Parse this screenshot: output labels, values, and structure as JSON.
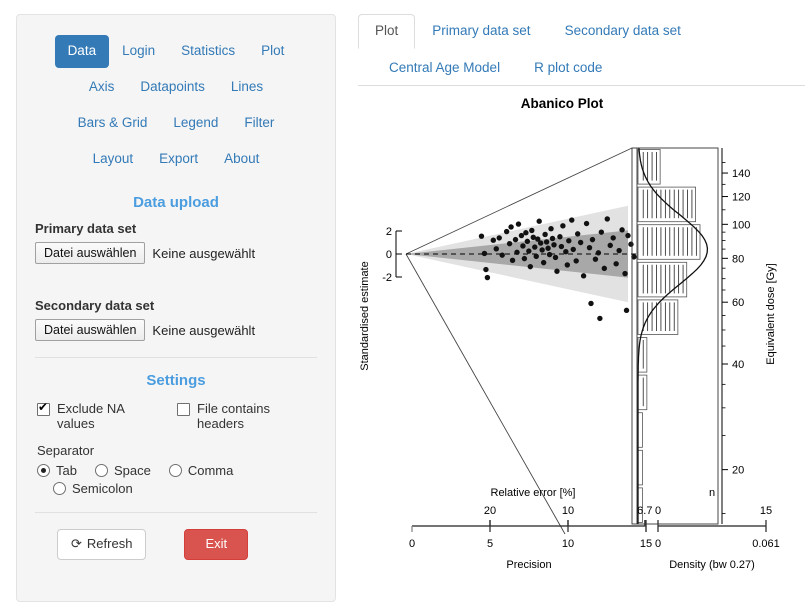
{
  "sidebar": {
    "nav_rows": [
      [
        {
          "label": "Data",
          "active": true
        },
        {
          "label": "Login",
          "active": false
        },
        {
          "label": "Statistics",
          "active": false
        },
        {
          "label": "Plot",
          "active": false
        }
      ],
      [
        {
          "label": "Axis",
          "active": false
        },
        {
          "label": "Datapoints",
          "active": false
        },
        {
          "label": "Lines",
          "active": false
        }
      ],
      [
        {
          "label": "Bars & Grid",
          "active": false
        },
        {
          "label": "Legend",
          "active": false
        },
        {
          "label": "Filter",
          "active": false
        }
      ],
      [
        {
          "label": "Layout",
          "active": false
        },
        {
          "label": "Export",
          "active": false
        },
        {
          "label": "About",
          "active": false
        }
      ]
    ],
    "data_upload": {
      "title": "Data upload",
      "primary_label": "Primary data set",
      "primary_button": "Datei auswählen",
      "primary_status": "Keine ausgewählt",
      "secondary_label": "Secondary data set",
      "secondary_button": "Datei auswählen",
      "secondary_status": "Keine ausgewählt"
    },
    "settings": {
      "title": "Settings",
      "checkboxes": [
        {
          "label": "Exclude NA values",
          "checked": true
        },
        {
          "label": "File contains headers",
          "checked": false
        }
      ],
      "separator_label": "Separator",
      "separator_options": [
        {
          "label": "Tab",
          "checked": true
        },
        {
          "label": "Space",
          "checked": false
        },
        {
          "label": "Comma",
          "checked": false
        },
        {
          "label": "Semicolon",
          "checked": false
        }
      ]
    },
    "buttons": {
      "refresh_label": "Refresh",
      "refresh_icon": "⟳",
      "exit_label": "Exit"
    }
  },
  "main": {
    "tab_rows": [
      [
        {
          "label": "Plot",
          "active": true
        },
        {
          "label": "Primary data set",
          "active": false
        },
        {
          "label": "Secondary data set",
          "active": false
        }
      ],
      [
        {
          "label": "Central Age Model",
          "active": false
        },
        {
          "label": "R plot code",
          "active": false
        }
      ]
    ]
  },
  "chart_data": {
    "type": "scatter",
    "title": "Abanico Plot",
    "ylabel_left": "Standardised estimate",
    "ylabel_right": "Equivalent dose [Gy]",
    "top_axis_label": "Relative error [%]",
    "top_axis_ticks": [
      "20",
      "10",
      "6.7"
    ],
    "top_axis_tick_values": [
      20,
      10,
      6.7
    ],
    "bottom_axis_label": "Precision",
    "bottom_axis_ticks": [
      "0",
      "5",
      "10",
      "15"
    ],
    "bottom_axis_tick_values": [
      0,
      5,
      10,
      15
    ],
    "density_top_label": "n",
    "density_top_ticks": [
      "0",
      "15"
    ],
    "density_top_tick_values": [
      0,
      15
    ],
    "density_bottom_label": "Density (bw 0.27)",
    "density_bottom_ticks": [
      "0",
      "0.061"
    ],
    "density_bottom_tick_values": [
      0,
      0.061
    ],
    "left_axis_ticks": [
      "2",
      "0",
      "-2"
    ],
    "left_axis_tick_values": [
      2,
      0,
      -2
    ],
    "right_axis_ticks": [
      "140",
      "120",
      "100",
      "80",
      "60",
      "40",
      "20"
    ],
    "right_axis_tick_values": [
      140,
      120,
      100,
      80,
      60,
      40,
      20
    ],
    "right_axis_scale": "log",
    "central_value": 67,
    "grid": false,
    "legend": "none",
    "points": [
      [
        5.1,
        1.55
      ],
      [
        5.3,
        0.05
      ],
      [
        5.4,
        -1.35
      ],
      [
        5.5,
        -2.05
      ],
      [
        5.9,
        1.2
      ],
      [
        6.1,
        0.45
      ],
      [
        6.3,
        1.4
      ],
      [
        6.5,
        -0.1
      ],
      [
        6.8,
        1.95
      ],
      [
        7.0,
        0.9
      ],
      [
        7.1,
        2.35
      ],
      [
        7.2,
        -0.55
      ],
      [
        7.4,
        1.25
      ],
      [
        7.5,
        0.15
      ],
      [
        7.6,
        2.6
      ],
      [
        7.8,
        1.6
      ],
      [
        7.9,
        0.7
      ],
      [
        8.0,
        -0.4
      ],
      [
        8.1,
        1.85
      ],
      [
        8.2,
        1.1
      ],
      [
        8.3,
        0.25
      ],
      [
        8.4,
        -1.1
      ],
      [
        8.5,
        2.05
      ],
      [
        8.6,
        1.45
      ],
      [
        8.7,
        0.6
      ],
      [
        8.8,
        -0.2
      ],
      [
        8.9,
        1.3
      ],
      [
        9.0,
        2.85
      ],
      [
        9.1,
        0.95
      ],
      [
        9.2,
        0.35
      ],
      [
        9.3,
        -0.75
      ],
      [
        9.4,
        1.7
      ],
      [
        9.5,
        1.05
      ],
      [
        9.6,
        0.5
      ],
      [
        9.7,
        -0.05
      ],
      [
        9.8,
        2.2
      ],
      [
        9.9,
        1.35
      ],
      [
        10.0,
        0.8
      ],
      [
        10.1,
        -0.3
      ],
      [
        10.2,
        -1.5
      ],
      [
        10.4,
        1.5
      ],
      [
        10.5,
        0.65
      ],
      [
        10.6,
        2.45
      ],
      [
        10.8,
        0.2
      ],
      [
        10.9,
        -0.95
      ],
      [
        11.0,
        1.15
      ],
      [
        11.2,
        2.95
      ],
      [
        11.3,
        0.4
      ],
      [
        11.5,
        -0.6
      ],
      [
        11.6,
        1.75
      ],
      [
        11.8,
        1.0
      ],
      [
        12.0,
        -1.9
      ],
      [
        12.2,
        2.65
      ],
      [
        12.4,
        0.55
      ],
      [
        12.6,
        1.25
      ],
      [
        12.8,
        -0.45
      ],
      [
        13.0,
        0.1
      ],
      [
        13.2,
        1.9
      ],
      [
        13.4,
        -1.25
      ],
      [
        13.6,
        3.05
      ],
      [
        13.8,
        0.75
      ],
      [
        14.0,
        1.4
      ],
      [
        14.2,
        -0.85
      ],
      [
        14.4,
        0.3
      ],
      [
        14.6,
        2.1
      ],
      [
        14.8,
        -1.7
      ],
      [
        15.0,
        1.6
      ],
      [
        15.2,
        0.85
      ],
      [
        15.4,
        -0.25
      ],
      [
        15.6,
        2.75
      ],
      [
        15.8,
        1.2
      ],
      [
        16.0,
        -1.05
      ],
      [
        16.2,
        0.0
      ],
      [
        16.4,
        -2.4
      ],
      [
        16.6,
        1.85
      ],
      [
        16.8,
        -3.1
      ],
      [
        17.0,
        0.6
      ],
      [
        17.2,
        -1.45
      ],
      [
        17.4,
        2.3
      ],
      [
        17.6,
        -2.75
      ],
      [
        12.5,
        -4.3
      ],
      [
        14.9,
        -4.9
      ],
      [
        16.9,
        -3.9
      ],
      [
        13.1,
        -5.6
      ]
    ],
    "histogram": {
      "bin_counts": [
        5,
        13,
        14,
        11,
        9,
        2,
        2,
        1,
        1,
        1
      ],
      "orientation": "horizontal",
      "rug": true
    },
    "kde": {
      "bandwidth": 0.27,
      "max_density": 0.061
    }
  }
}
